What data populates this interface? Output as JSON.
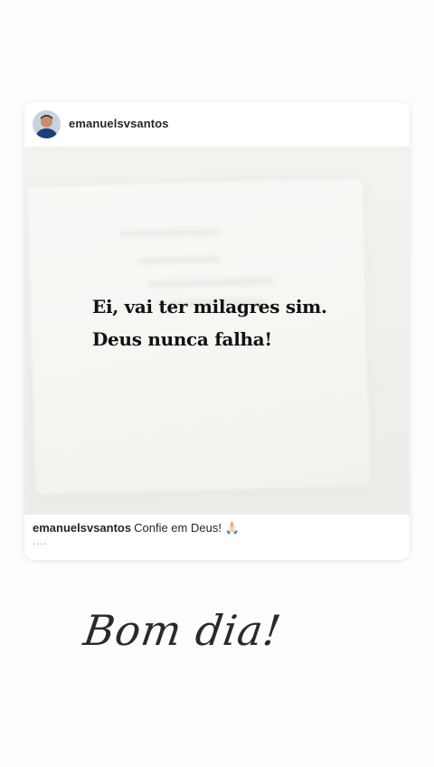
{
  "post": {
    "username": "emanuelsvsantos",
    "quote_lines": [
      "Ei, vai ter milagres sim.",
      "Deus nunca falha!"
    ],
    "caption": {
      "username": "emanuelsvsantos",
      "text": "Confie em Deus! 🙏🏻",
      "more": "...."
    }
  },
  "greeting": "Bom dia!"
}
